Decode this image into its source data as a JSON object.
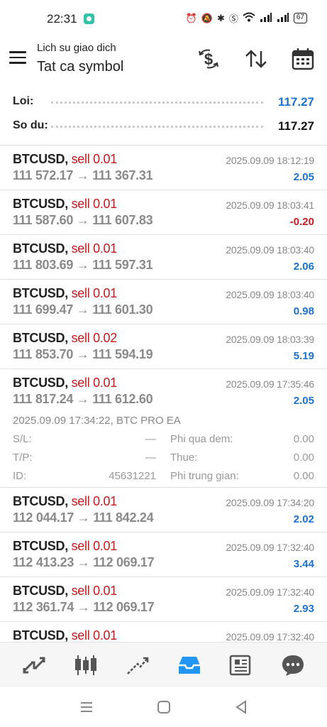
{
  "status_bar": {
    "time": "22:31",
    "battery": "67"
  },
  "header": {
    "subtitle": "Lich su giao dich",
    "title": "Tat ca symbol"
  },
  "summary": {
    "profit_label": "Loi:",
    "profit_value": "117.27",
    "balance_label": "So du:",
    "balance_value": "117.27"
  },
  "colors": {
    "positive": "#1c72d1",
    "negative": "#c8191e",
    "accent": "#2196f3"
  },
  "trades": [
    {
      "symbol": "BTCUSD,",
      "side": "sell 0.01",
      "time": "2025.09.09 18:12:19",
      "prices": "111 572.17 → 111 367.31",
      "profit": "2.05",
      "sign": "pos"
    },
    {
      "symbol": "BTCUSD,",
      "side": "sell 0.01",
      "time": "2025.09.09 18:03:41",
      "prices": "111 587.60 → 111 607.83",
      "profit": "-0.20",
      "sign": "neg"
    },
    {
      "symbol": "BTCUSD,",
      "side": "sell 0.01",
      "time": "2025.09.09 18:03:40",
      "prices": "111 803.69 → 111 597.31",
      "profit": "2.06",
      "sign": "pos"
    },
    {
      "symbol": "BTCUSD,",
      "side": "sell 0.01",
      "time": "2025.09.09 18:03:40",
      "prices": "111 699.47 → 111 601.30",
      "profit": "0.98",
      "sign": "pos"
    },
    {
      "symbol": "BTCUSD,",
      "side": "sell 0.02",
      "time": "2025.09.09 18:03:39",
      "prices": "111 853.70 → 111 594.19",
      "profit": "5.19",
      "sign": "pos"
    },
    {
      "symbol": "BTCUSD,",
      "side": "sell 0.01",
      "time": "2025.09.09 17:35:46",
      "prices": "111 817.24 → 111 612.60",
      "profit": "2.05",
      "sign": "pos",
      "details": {
        "open_info": "2025.09.09 17:34:22, BTC PRO EA",
        "sl_label": "S/L:",
        "sl_value": "—",
        "tp_label": "T/P:",
        "tp_value": "—",
        "id_label": "ID:",
        "id_value": "45631221",
        "swap_label": "Phi qua dem:",
        "swap_value": "0.00",
        "tax_label": "Thue:",
        "tax_value": "0.00",
        "commission_label": "Phi trung gian:",
        "commission_value": "0.00"
      }
    },
    {
      "symbol": "BTCUSD,",
      "side": "sell 0.01",
      "time": "2025.09.09 17:34:20",
      "prices": "112 044.17 → 111 842.24",
      "profit": "2.02",
      "sign": "pos"
    },
    {
      "symbol": "BTCUSD,",
      "side": "sell 0.01",
      "time": "2025.09.09 17:32:40",
      "prices": "112 413.23 → 112 069.17",
      "profit": "3.44",
      "sign": "pos"
    },
    {
      "symbol": "BTCUSD,",
      "side": "sell 0.01",
      "time": "2025.09.09 17:32:40",
      "prices": "112 361.74 → 112 069.17",
      "profit": "2.93",
      "sign": "pos"
    },
    {
      "symbol": "BTCUSD,",
      "side": "sell 0.01",
      "time": "2025.09.09 17:32:40",
      "prices": "",
      "profit": "",
      "sign": "pos"
    }
  ],
  "bottom_nav": [
    "quotes-icon",
    "chart-icon",
    "trade-icon",
    "history-icon",
    "news-icon",
    "messages-icon"
  ],
  "active_tab": "history-icon"
}
